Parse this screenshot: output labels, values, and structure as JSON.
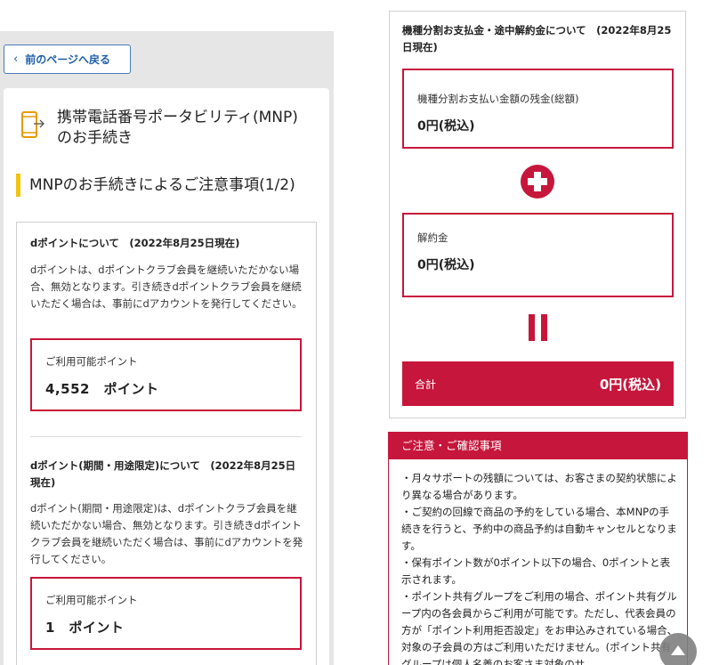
{
  "left": {
    "back_button": "前のページへ戻る",
    "page_title": "携帯電話番号ポータビリティ(MNP)のお手続き",
    "section_title": "MNPのお手続きによるご注意事項(1/2)",
    "dpoint": {
      "title": "dポイントについて　(2022年8月25日現在)",
      "description": "dポイントは、dポイントクラブ会員を継続いただかない場合、無効となります。引き続きdポイントクラブ会員を継続いただく場合は、事前にdアカウントを発行してください。",
      "available_label": "ご利用可能ポイント",
      "available_value": "4,552　ポイント"
    },
    "dpoint_limited": {
      "title": "dポイント(期間・用途限定)について　(2022年8月25日現在)",
      "description": "dポイント(期間・用途限定)は、dポイントクラブ会員を継続いただかない場合、無効となります。引き続きdポイントクラブ会員を継続いただく場合は、事前にdアカウントを発行してください。",
      "available_label": "ご利用可能ポイント",
      "available_value": "1　ポイント"
    }
  },
  "right": {
    "installment": {
      "title": "機種分割お支払金・途中解約金について　(2022年8月25日現在)",
      "remaining_label": "機種分割お支払い金額の残金(総額)",
      "remaining_value": "0円(税込)",
      "cancellation_label": "解約金",
      "cancellation_value": "0円(税込)",
      "total_label": "合計",
      "total_value": "0円(税込)"
    },
    "notice": {
      "header": "ご注意・ご確認事項",
      "items": [
        "・月々サポートの残額については、お客さまの契約状態により異なる場合があります。",
        "・ご契約の回線で商品の予約をしている場合、本MNPの手続きを行うと、予約中の商品予約は自動キャンセルとなります。",
        "・保有ポイント数が0ポイント以下の場合、0ポイントと表示されます。",
        "・ポイント共有グループをご利用の場合、ポイント共有グループ内の各会員からご利用が可能です。ただし、代表会員の方が「ポイント利用拒否設定」をお申込みされている場合、対象の子会員の方はご利用いただけません。(ポイント共有グループは個人名義のお客さま対象のサ"
      ]
    }
  },
  "colors": {
    "accent_red": "#c7163b",
    "link_blue": "#1f5ea8",
    "heading_bar_yellow": "#f1c40f"
  },
  "icons": [
    "chevron-left-icon",
    "phone-transfer-icon",
    "plus-icon",
    "equals-icon",
    "arrow-up-icon"
  ]
}
